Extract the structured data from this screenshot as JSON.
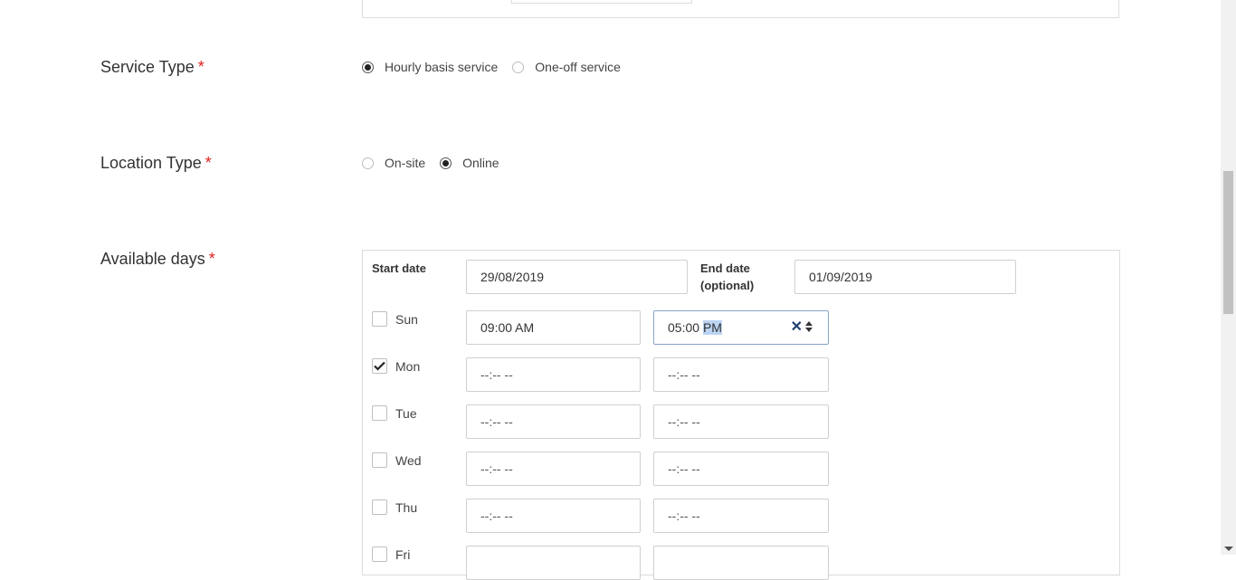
{
  "service_type": {
    "label": "Service Type",
    "required": "*",
    "options": [
      {
        "label": "Hourly basis service",
        "selected": true
      },
      {
        "label": "One-off service",
        "selected": false
      }
    ]
  },
  "location_type": {
    "label": "Location Type",
    "required": "*",
    "options": [
      {
        "label": "On-site",
        "selected": false
      },
      {
        "label": "Online",
        "selected": true
      }
    ]
  },
  "available_days": {
    "label": "Available days",
    "required": "*",
    "start_date_label": "Start date",
    "start_date_value": "29/08/2019",
    "end_date_label_line1": "End date",
    "end_date_label_line2": "(optional)",
    "end_date_value": "01/09/2019",
    "days": [
      {
        "day": "Sun",
        "checked": false,
        "from": "09:00 AM",
        "to_time": "05:00",
        "to_period": "PM"
      },
      {
        "day": "Mon",
        "checked": true,
        "from": "--:-- --",
        "to": "--:-- --"
      },
      {
        "day": "Tue",
        "checked": false,
        "from": "--:-- --",
        "to": "--:-- --"
      },
      {
        "day": "Wed",
        "checked": false,
        "from": "--:-- --",
        "to": "--:-- --"
      },
      {
        "day": "Thu",
        "checked": false,
        "from": "--:-- --",
        "to": "--:-- --"
      },
      {
        "day": "Fri",
        "checked": false
      }
    ]
  },
  "icons": {
    "clear": "close-icon",
    "spinner": "spinner-icon",
    "check": "checkmark-icon"
  }
}
